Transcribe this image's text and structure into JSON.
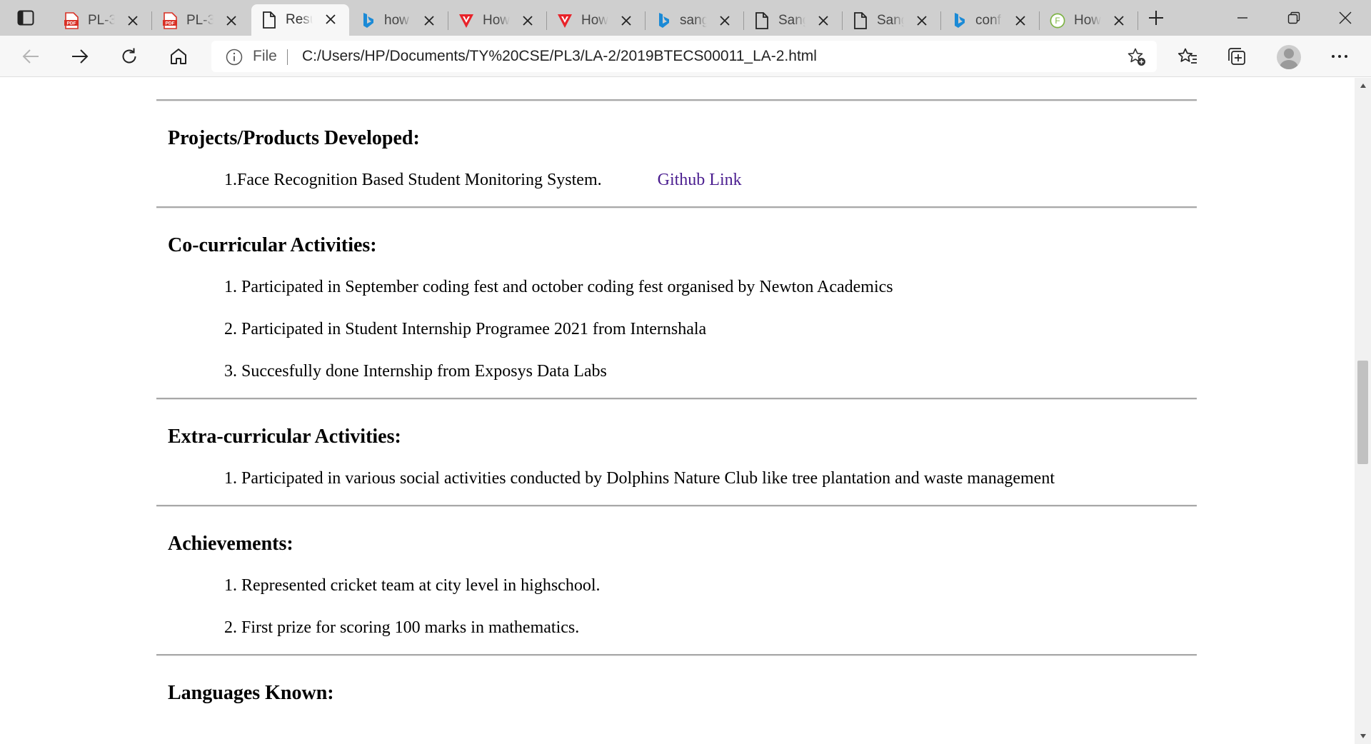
{
  "browser": {
    "tabs": [
      {
        "title": "PL-3",
        "icon": "pdf-icon"
      },
      {
        "title": "PL-3",
        "icon": "pdf-icon"
      },
      {
        "title": "Resume",
        "icon": "file-icon",
        "active": true
      },
      {
        "title": "how",
        "icon": "bing-icon"
      },
      {
        "title": "How",
        "icon": "v-brand-icon"
      },
      {
        "title": "How",
        "icon": "v-brand-icon"
      },
      {
        "title": "sang",
        "icon": "bing-icon"
      },
      {
        "title": "Sang",
        "icon": "file-icon"
      },
      {
        "title": "Sang",
        "icon": "file-icon"
      },
      {
        "title": "conf",
        "icon": "bing-icon"
      },
      {
        "title": "How",
        "icon": "f-circle-icon"
      }
    ],
    "address": {
      "scheme": "File",
      "url": "C:/Users/HP/Documents/TY%20CSE/PL3/LA-2/2019BTECS00011_LA-2.html"
    }
  },
  "resume": {
    "projects": {
      "heading": "Projects/Products Developed:",
      "items": [
        {
          "text": "1.Face Recognition Based Student Monitoring System.",
          "link": "Github Link"
        }
      ]
    },
    "cocurricular": {
      "heading": "Co-curricular Activities:",
      "items": [
        "1. Participated in September coding fest and october coding fest organised by Newton Academics",
        "2. Participated in Student Internship Programee 2021 from Internshala",
        "3. Succesfully done Internship from Exposys Data Labs"
      ]
    },
    "extracurricular": {
      "heading": "Extra-curricular Activities:",
      "items": [
        "1. Participated in various social activities conducted by Dolphins Nature Club like tree plantation and waste management"
      ]
    },
    "achievements": {
      "heading": "Achievements:",
      "items": [
        "1. Represented cricket team at city level in highschool.",
        "2. First prize for scoring 100 marks in mathematics."
      ]
    },
    "languages": {
      "heading": "Languages Known:"
    }
  },
  "colors": {
    "link": "#4a1d8f",
    "tabstrip": "#cfcfcf",
    "toolbar": "#f7f7f7",
    "pdf_red": "#d93025",
    "bing_blue": "#1b8ad6"
  }
}
